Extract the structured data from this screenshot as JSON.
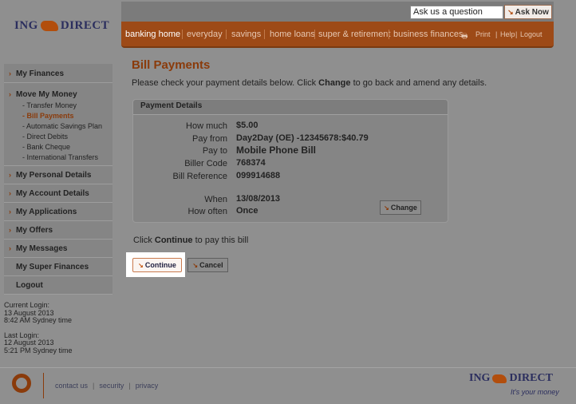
{
  "brand": {
    "logo_left": "ING",
    "logo_right": "DIRECT",
    "tagline": "It's your money"
  },
  "header": {
    "search_placeholder": "Ask us a question",
    "ask_label": "Ask Now",
    "nav": [
      "banking home",
      "everyday",
      "savings",
      "home loans",
      "super & retirement",
      "business finances"
    ],
    "utility": {
      "print": "Print",
      "help": "Help",
      "logout": "Logout"
    }
  },
  "sidebar": {
    "my_finances": "My Finances",
    "move_my_money": "Move My Money",
    "sub": [
      "Transfer Money",
      "Bill Payments",
      "Automatic Savings Plan",
      "Direct Debits",
      "Bank Cheque",
      "International Transfers"
    ],
    "personal": "My Personal Details",
    "account": "My Account Details",
    "applications": "My Applications",
    "offers": "My Offers",
    "messages": "My Messages",
    "super": "My Super Finances",
    "logout": "Logout"
  },
  "login": {
    "current_label": "Current Login:",
    "current_date": "13 August 2013",
    "current_time": "8:42 AM Sydney time",
    "last_label": "Last Login:",
    "last_date": "12 August 2013",
    "last_time": "5:21 PM Sydney time"
  },
  "main": {
    "title": "Bill Payments",
    "intro_pre": "Please check your payment details below. Click ",
    "intro_bold": "Change",
    "intro_post": " to go back and amend any details.",
    "panel_title": "Payment Details",
    "fields": {
      "how_much_label": "How much",
      "how_much": "$5.00",
      "pay_from_label": "Pay from",
      "pay_from": "Day2Day (OE) -12345678:$40.79",
      "pay_to_label": "Pay to",
      "pay_to": "Mobile Phone Bill",
      "biller_code_label": "Biller Code",
      "biller_code": "768374",
      "bill_ref_label": "Bill Reference",
      "bill_ref": "099914688",
      "when_label": "When",
      "when": "13/08/2013",
      "how_often_label": "How often",
      "how_often": "Once"
    },
    "change_label": "Change",
    "click_pre": "Click ",
    "click_bold": "Continue",
    "click_post": " to pay this bill",
    "continue_label": "Continue",
    "cancel_label": "Cancel"
  },
  "footer": {
    "contact": "contact us",
    "security": "security",
    "privacy": "privacy"
  }
}
